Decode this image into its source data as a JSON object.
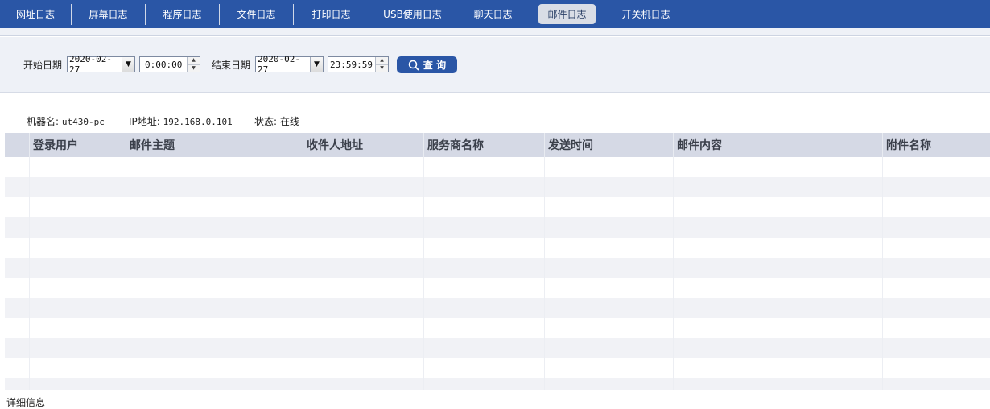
{
  "tabs": [
    {
      "label": "网址日志",
      "active": false
    },
    {
      "label": "屏幕日志",
      "active": false
    },
    {
      "label": "程序日志",
      "active": false
    },
    {
      "label": "文件日志",
      "active": false
    },
    {
      "label": "打印日志",
      "active": false
    },
    {
      "label": "USB使用日志",
      "active": false
    },
    {
      "label": "聊天日志",
      "active": false
    },
    {
      "label": "邮件日志",
      "active": true
    },
    {
      "label": "开关机日志",
      "active": false
    }
  ],
  "filter": {
    "start_label": "开始日期",
    "start_date": "2020-02-27",
    "start_time": "0:00:00",
    "end_label": "结束日期",
    "end_date": "2020-02-27",
    "end_time": "23:59:59",
    "query_label": "查 询"
  },
  "machine": {
    "name_label": "机器名:",
    "name_value": "ut430-pc",
    "ip_label": "IP地址:",
    "ip_value": "192.168.0.101",
    "status_label": "状态:",
    "status_value": "在线"
  },
  "table": {
    "columns": [
      "",
      "登录用户",
      "邮件主题",
      "收件人地址",
      "服务商名称",
      "发送时间",
      "邮件内容",
      "附件名称"
    ],
    "rows": []
  },
  "detail_label": "详细信息",
  "colors": {
    "accent": "#2a56a6",
    "header_bg": "#d5d9e5",
    "panel_bg": "#eef1f7"
  }
}
